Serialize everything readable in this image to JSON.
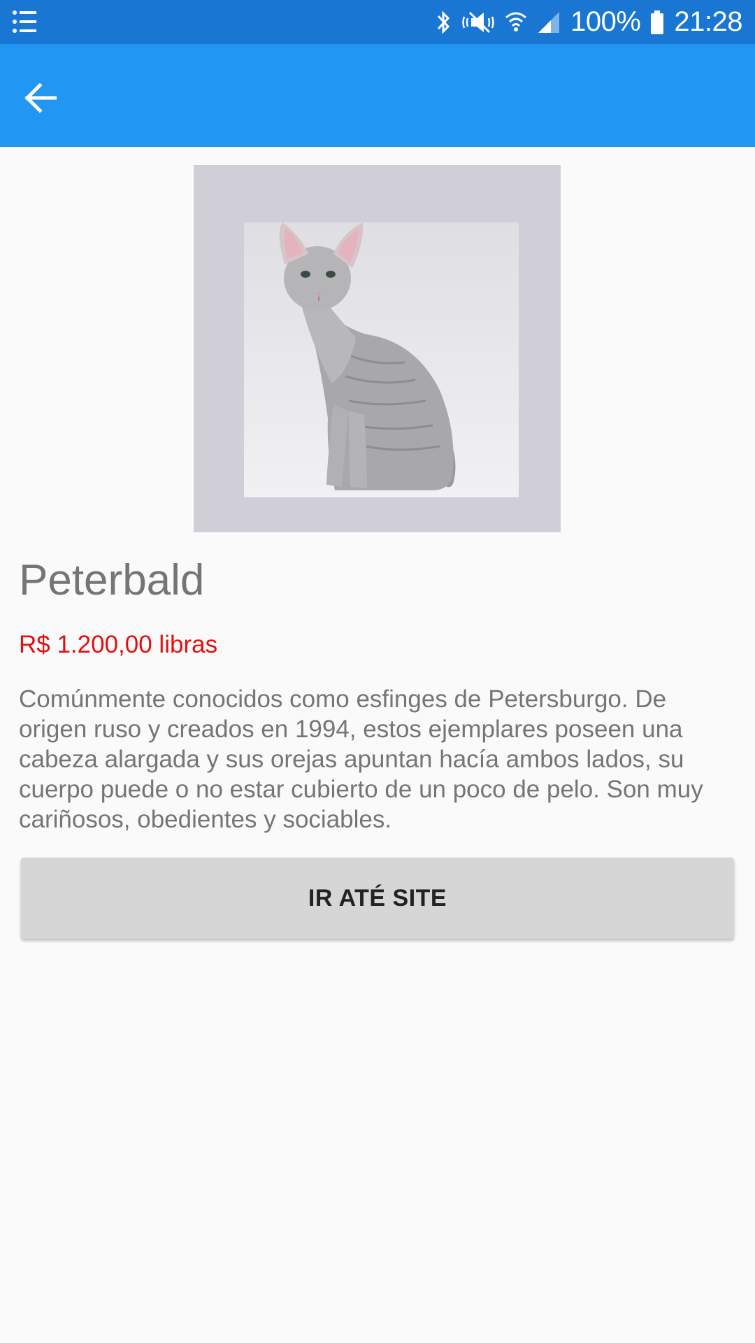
{
  "status_bar": {
    "battery_percent": "100%",
    "time": "21:28",
    "icons": [
      "list-icon",
      "bluetooth-icon",
      "mute-icon",
      "wifi-icon",
      "signal-icon",
      "battery-icon"
    ]
  },
  "app_bar": {
    "back_icon": "arrow-left-icon",
    "color": "#2196f3",
    "status_color": "#1976d2"
  },
  "product": {
    "title": "Peterbald",
    "price": "R$ 1.200,00 libras",
    "description": "Comúnmente conocidos como esfinges de Petersburgo. De origen ruso y creados en 1994, estos ejemplares poseen una cabeza alargada y sus orejas apuntan hacía ambos lados, su cuerpo puede o no estar cubierto de un poco de pelo. Son muy cariñosos, obedientes y sociables.",
    "price_color": "#e01010"
  },
  "actions": {
    "site_button_label": "IR ATÉ SITE"
  }
}
